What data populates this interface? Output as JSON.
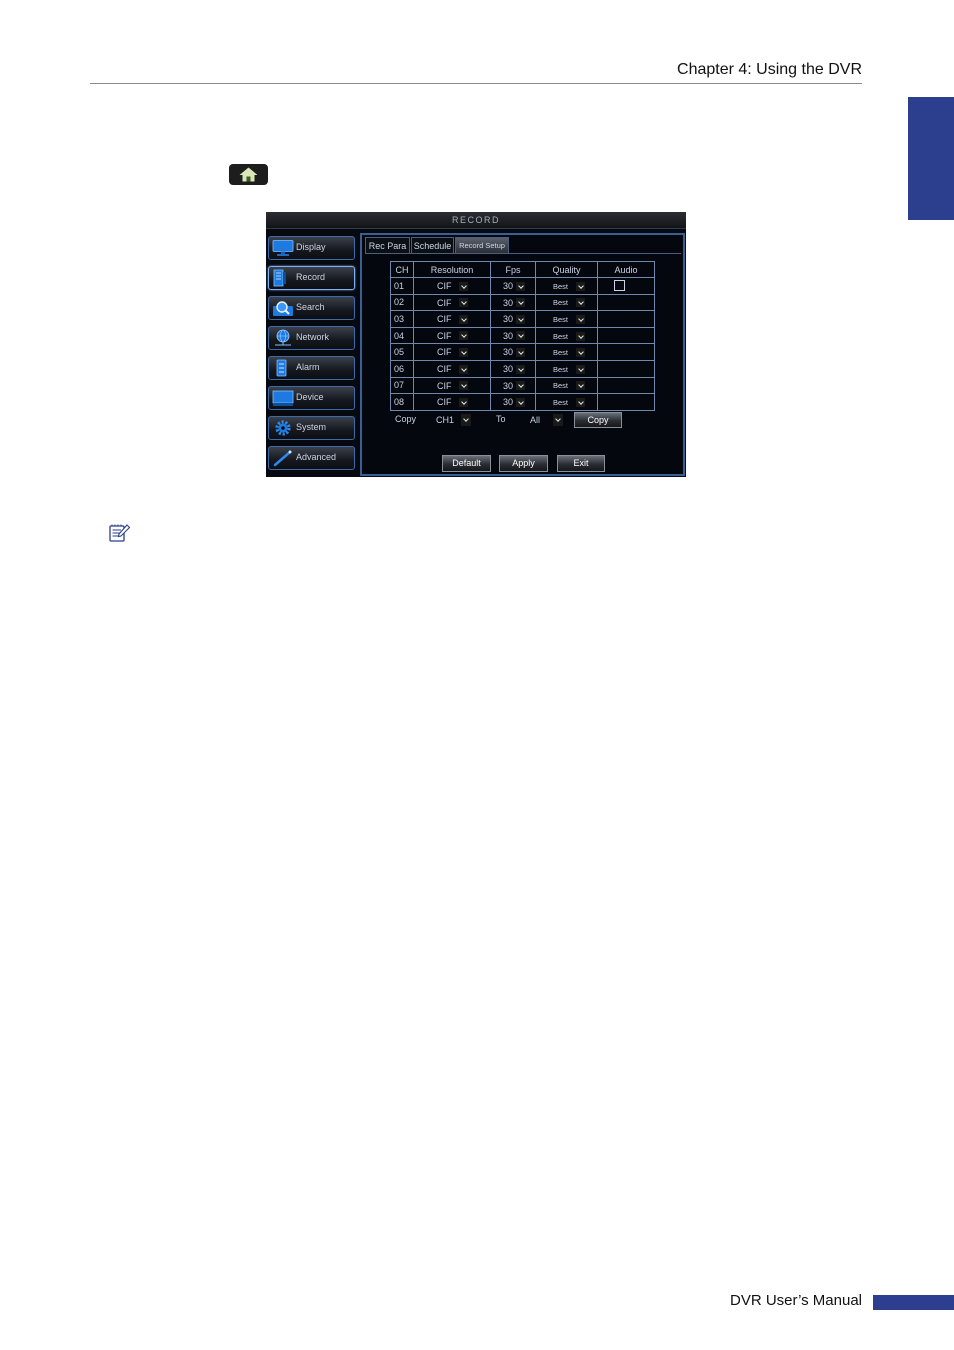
{
  "page": {
    "header_title": "Chapter 4: Using the DVR",
    "footer_title": "DVR User’s Manual",
    "accent_color": "#2b3f8e"
  },
  "home_button": {
    "icon": "home-icon"
  },
  "dvr": {
    "window_title": "RECORD",
    "sidebar": {
      "items": [
        {
          "label": "Display",
          "icon": "monitor-icon",
          "active": false
        },
        {
          "label": "Record",
          "icon": "record-icon",
          "active": true
        },
        {
          "label": "Search",
          "icon": "search-icon",
          "active": false
        },
        {
          "label": "Network",
          "icon": "network-icon",
          "active": false
        },
        {
          "label": "Alarm",
          "icon": "alarm-icon",
          "active": false
        },
        {
          "label": "Device",
          "icon": "device-icon",
          "active": false
        },
        {
          "label": "System",
          "icon": "gear-icon",
          "active": false
        },
        {
          "label": "Advanced",
          "icon": "wand-icon",
          "active": false
        }
      ]
    },
    "tabs": [
      {
        "label": "Rec Para",
        "active": false
      },
      {
        "label": "Schedule",
        "active": false
      },
      {
        "label": "Record Setup",
        "active": true
      }
    ],
    "table": {
      "headers": [
        "CH",
        "Resolution",
        "Fps",
        "Quality",
        "Audio"
      ],
      "rows": [
        {
          "ch": "01",
          "resolution": "CIF",
          "fps": "30",
          "quality": "Best",
          "audio_checkbox": true,
          "audio_checked": false
        },
        {
          "ch": "02",
          "resolution": "CIF",
          "fps": "30",
          "quality": "Best",
          "audio_checkbox": false
        },
        {
          "ch": "03",
          "resolution": "CIF",
          "fps": "30",
          "quality": "Best",
          "audio_checkbox": false
        },
        {
          "ch": "04",
          "resolution": "CIF",
          "fps": "30",
          "quality": "Best",
          "audio_checkbox": false
        },
        {
          "ch": "05",
          "resolution": "CIF",
          "fps": "30",
          "quality": "Best",
          "audio_checkbox": false
        },
        {
          "ch": "06",
          "resolution": "CIF",
          "fps": "30",
          "quality": "Best",
          "audio_checkbox": false
        },
        {
          "ch": "07",
          "resolution": "CIF",
          "fps": "30",
          "quality": "Best",
          "audio_checkbox": false
        },
        {
          "ch": "08",
          "resolution": "CIF",
          "fps": "30",
          "quality": "Best",
          "audio_checkbox": false
        }
      ]
    },
    "copy_row": {
      "label": "Copy",
      "from": "CH1",
      "to_label": "To",
      "to": "All",
      "button": "Copy"
    },
    "buttons": {
      "default": "Default",
      "apply": "Apply",
      "exit": "Exit"
    },
    "colors": {
      "background": "#06090f",
      "border": "#3b5e94",
      "text": "#c9d2e6"
    }
  },
  "note": {
    "icon": "note-icon"
  }
}
